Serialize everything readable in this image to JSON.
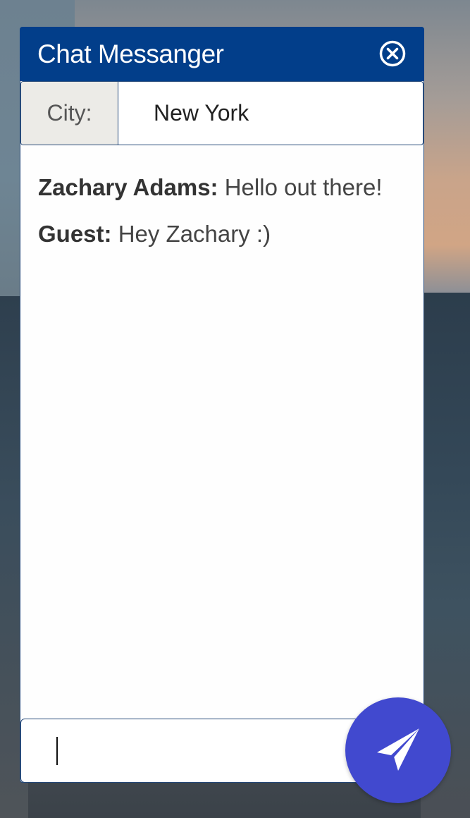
{
  "header": {
    "title": "Chat Messanger"
  },
  "city": {
    "label": "City:",
    "value": "New York"
  },
  "messages": [
    {
      "sender": "Zachary Adams:",
      "text": "Hello out there!"
    },
    {
      "sender": "Guest:",
      "text": "Hey Zachary :)"
    }
  ],
  "composer": {
    "value": ""
  },
  "icons": {
    "close": "close-circle-icon",
    "send": "paper-plane-icon"
  },
  "colors": {
    "header_bg": "#023e8a",
    "send_button_bg": "#4149cf",
    "city_label_bg": "#ecebe7"
  }
}
